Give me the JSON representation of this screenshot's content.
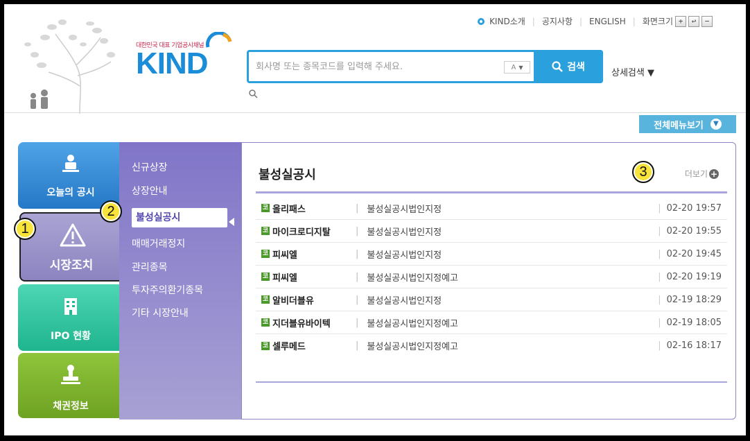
{
  "header": {
    "logo_tagline": "대한민국 대표 기업공시채널",
    "logo_text": "KIND",
    "top_links": [
      "KIND소개",
      "공지사항",
      "ENGLISH",
      "화면크기"
    ],
    "zoom_buttons": [
      "+",
      "↩",
      "−"
    ],
    "search_placeholder": "회사명 또는 종목코드를 입력해 주세요.",
    "search_ac": "A",
    "search_button": "검색",
    "advanced_search": "상세검색 ▼",
    "all_menu": "전체메뉴보기"
  },
  "tabs": [
    {
      "label": "오늘의 공시",
      "icon": "person-icon"
    },
    {
      "label": "시장조치",
      "icon": "warning-icon"
    },
    {
      "label": "IPO 현황",
      "icon": "building-icon"
    },
    {
      "label": "채권정보",
      "icon": "stamp-icon"
    }
  ],
  "submenu": {
    "items": [
      "신규상장",
      "상장안내",
      "불성실공시",
      "매매거래정지",
      "관리종목",
      "투자주의환기종목",
      "기타 시장안내"
    ],
    "active_index": 2
  },
  "panel": {
    "title": "불성실공시",
    "more": "더보기",
    "badge": "코",
    "rows": [
      {
        "name": "올리패스",
        "desc": "불성실공시법인지정",
        "time": "02-20 19:57"
      },
      {
        "name": "마이크로디지탈",
        "desc": "불성실공시법인지정",
        "time": "02-20 19:55"
      },
      {
        "name": "피씨엘",
        "desc": "불성실공시법인지정",
        "time": "02-20 19:45"
      },
      {
        "name": "피씨엘",
        "desc": "불성실공시법인지정예고",
        "time": "02-20 19:19"
      },
      {
        "name": "알비더블유",
        "desc": "불성실공시법인지정",
        "time": "02-19 18:29"
      },
      {
        "name": "지더블유바이텍",
        "desc": "불성실공시법인지정예고",
        "time": "02-19 18:05"
      },
      {
        "name": "셀루메드",
        "desc": "불성실공시법인지정예고",
        "time": "02-16 18:17"
      }
    ]
  },
  "annotations": [
    "1",
    "2",
    "3"
  ],
  "colors": {
    "accent": "#2aa0dd",
    "submenu": "#8075c8",
    "badge": "#4a9a2a",
    "marker": "#f7e33a"
  }
}
